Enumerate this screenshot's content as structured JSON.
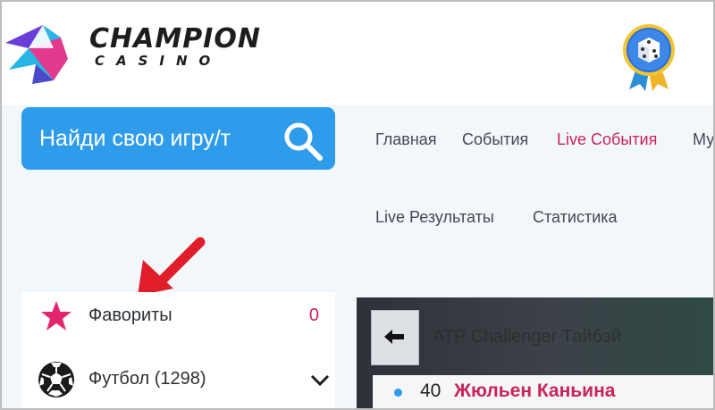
{
  "logo": {
    "title": "CHAMPION",
    "subtitle": "CASINO"
  },
  "search": {
    "placeholder": "Найди свою игру/т"
  },
  "nav": {
    "row1": [
      "Главная",
      "События",
      "Live События",
      "Му"
    ],
    "row2": [
      "Live Результаты",
      "Статистика"
    ],
    "active": "Live События"
  },
  "sidebar": {
    "items": [
      {
        "label": "Фавориты",
        "count": "0",
        "icon": "star-icon"
      },
      {
        "label": "Футбол (1298)",
        "icon": "soccer-ball-icon",
        "expand_icon": "chevron-down-icon"
      }
    ]
  },
  "banner": {
    "tournament": "ATP Challenger Тайбэй",
    "match": {
      "score": "40",
      "player": "Жюльен Каньина"
    }
  },
  "icons": [
    "champion-logo-icon",
    "medal-dice-icon",
    "search-icon",
    "red-arrow-icon",
    "back-arrow-icon"
  ],
  "colors": {
    "accent_blue": "#2f9ceb",
    "accent_pink": "#c9235a",
    "banner_dark": "#2c3238"
  }
}
